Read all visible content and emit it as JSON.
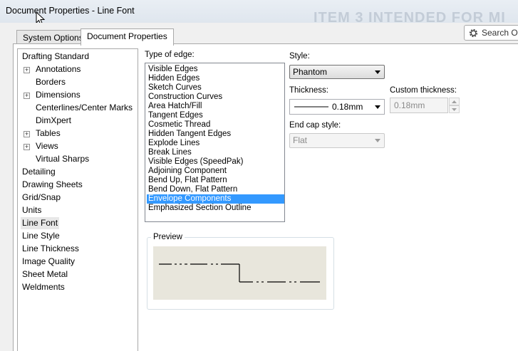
{
  "window": {
    "title": "Document Properties - Line Font",
    "background_watermark": "ITEM 3 INTENDED FOR MI"
  },
  "tabs": [
    {
      "label": "System Options",
      "active": false
    },
    {
      "label": "Document Properties",
      "active": true
    }
  ],
  "search": {
    "label": "Search Op"
  },
  "tree": [
    {
      "label": "Drafting Standard",
      "level": 0,
      "expander": false
    },
    {
      "label": "Annotations",
      "level": 1,
      "expander": true
    },
    {
      "label": "Borders",
      "level": 1,
      "expander": false
    },
    {
      "label": "Dimensions",
      "level": 1,
      "expander": true
    },
    {
      "label": "Centerlines/Center Marks",
      "level": 1,
      "expander": false
    },
    {
      "label": "DimXpert",
      "level": 1,
      "expander": false
    },
    {
      "label": "Tables",
      "level": 1,
      "expander": true
    },
    {
      "label": "Views",
      "level": 1,
      "expander": true
    },
    {
      "label": "Virtual Sharps",
      "level": 1,
      "expander": false
    },
    {
      "label": "Detailing",
      "level": 0,
      "expander": false
    },
    {
      "label": "Drawing Sheets",
      "level": 0,
      "expander": false
    },
    {
      "label": "Grid/Snap",
      "level": 0,
      "expander": false
    },
    {
      "label": "Units",
      "level": 0,
      "expander": false
    },
    {
      "label": "Line Font",
      "level": 0,
      "expander": false,
      "selected": true
    },
    {
      "label": "Line Style",
      "level": 0,
      "expander": false
    },
    {
      "label": "Line Thickness",
      "level": 0,
      "expander": false
    },
    {
      "label": "Image Quality",
      "level": 0,
      "expander": false
    },
    {
      "label": "Sheet Metal",
      "level": 0,
      "expander": false
    },
    {
      "label": "Weldments",
      "level": 0,
      "expander": false
    }
  ],
  "edge_types": {
    "label": "Type of edge:",
    "items": [
      "Visible Edges",
      "Hidden Edges",
      "Sketch Curves",
      "Construction Curves",
      "Area Hatch/Fill",
      "Tangent Edges",
      "Cosmetic Thread",
      "Hidden Tangent Edges",
      "Explode Lines",
      "Break Lines",
      "Visible Edges (SpeedPak)",
      "Adjoining Component",
      "Bend Up, Flat Pattern",
      "Bend Down, Flat Pattern",
      "Envelope Components",
      "Emphasized Section Outline"
    ],
    "selected": "Envelope Components"
  },
  "style": {
    "label": "Style:",
    "value": "Phantom"
  },
  "thickness": {
    "label": "Thickness:",
    "value": "0.18mm"
  },
  "custom_thickness": {
    "label": "Custom thickness:",
    "value": "0.18mm"
  },
  "end_cap": {
    "label": "End cap style:",
    "value": "Flat"
  },
  "preview": {
    "label": "Preview"
  },
  "colors": {
    "selection": "#3399ff",
    "preview_bg": "#e8e6dc"
  }
}
